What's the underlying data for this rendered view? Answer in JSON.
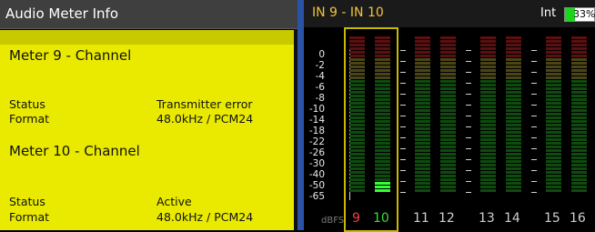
{
  "left": {
    "title": "Audio Meter Info",
    "meters": [
      {
        "heading": "Meter 9 - Channel",
        "rows": [
          {
            "label": "Status",
            "value": "Transmitter error"
          },
          {
            "label": "Format",
            "value": "48.0kHz / PCM24"
          }
        ]
      },
      {
        "heading": "Meter 10 - Channel",
        "rows": [
          {
            "label": "Status",
            "value": "Active"
          },
          {
            "label": "Format",
            "value": "48.0kHz / PCM24"
          }
        ]
      }
    ]
  },
  "right": {
    "title": "IN 9 - IN 10",
    "ref_label": "Int",
    "ref_percent_text": "33%",
    "ref_fraction": 0.33,
    "scale_ticks": [
      "0",
      "-2",
      "-4",
      "-6",
      "-8",
      "-10",
      "-14",
      "-18",
      "-22",
      "-26",
      "-30",
      "-40",
      "-50",
      "-65"
    ],
    "unit_label": "dBFS",
    "channels": [
      {
        "num": "9",
        "color": "#ff3b3b"
      },
      {
        "num": "10",
        "color": "#33e033"
      },
      {
        "num": "11",
        "color": "#cfcfcf"
      },
      {
        "num": "12",
        "color": "#cfcfcf"
      },
      {
        "num": "13",
        "color": "#cfcfcf"
      },
      {
        "num": "14",
        "color": "#cfcfcf"
      },
      {
        "num": "15",
        "color": "#cfcfcf"
      },
      {
        "num": "16",
        "color": "#cfcfcf"
      }
    ],
    "active_levels": {
      "10": 0.08
    }
  }
}
